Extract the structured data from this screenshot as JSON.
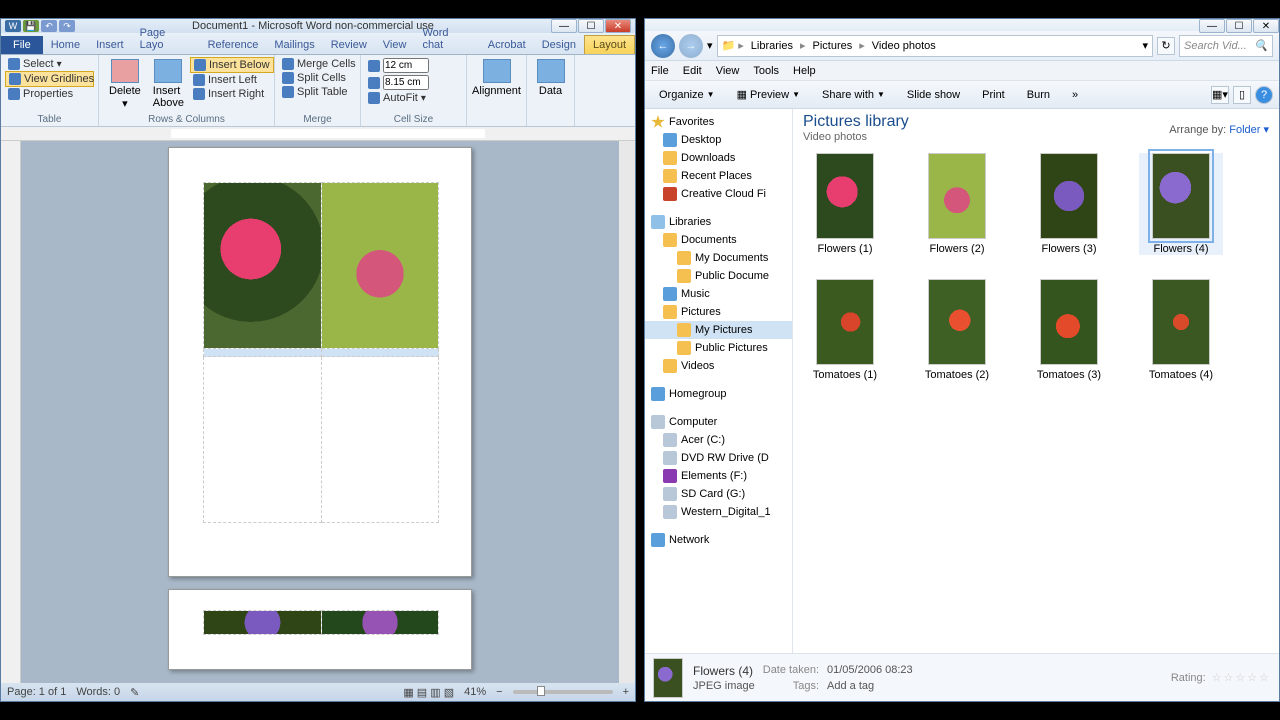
{
  "word": {
    "title": "Document1 - Microsoft Word non-commercial use",
    "tabs": {
      "file": "File",
      "home": "Home",
      "insert": "Insert",
      "pagelayout": "Page Layo",
      "references": "Reference",
      "mailings": "Mailings",
      "review": "Review",
      "view": "View",
      "wordchat": "Word chat",
      "acrobat": "Acrobat",
      "design": "Design",
      "layout": "Layout"
    },
    "ribbon": {
      "select": "Select",
      "gridlines": "View Gridlines",
      "properties": "Properties",
      "table_grp": "Table",
      "delete": "Delete",
      "insert_above": "Insert Above",
      "insert_below": "Insert Below",
      "insert_left": "Insert Left",
      "insert_right": "Insert Right",
      "rows_cols_grp": "Rows & Columns",
      "merge_cells": "Merge Cells",
      "split_cells": "Split Cells",
      "split_table": "Split Table",
      "merge_grp": "Merge",
      "height": "12 cm",
      "width": "8.15 cm",
      "autofit": "AutoFit",
      "cellsize_grp": "Cell Size",
      "alignment": "Alignment",
      "data": "Data"
    },
    "status": {
      "page": "Page: 1 of 1",
      "words": "Words: 0",
      "zoom": "41%"
    }
  },
  "explorer": {
    "breadcrumb": {
      "libraries": "Libraries",
      "pictures": "Pictures",
      "video": "Video photos"
    },
    "search_placeholder": "Search Vid...",
    "menu": {
      "file": "File",
      "edit": "Edit",
      "view": "View",
      "tools": "Tools",
      "help": "Help"
    },
    "toolbar": {
      "organize": "Organize",
      "preview": "Preview",
      "share": "Share with",
      "slideshow": "Slide show",
      "print": "Print",
      "burn": "Burn"
    },
    "nav": {
      "favorites": "Favorites",
      "desktop": "Desktop",
      "downloads": "Downloads",
      "recent": "Recent Places",
      "creative": "Creative Cloud Fi",
      "libraries": "Libraries",
      "documents": "Documents",
      "mydocs": "My Documents",
      "pubdocs": "Public Docume",
      "music": "Music",
      "pictures": "Pictures",
      "mypics": "My Pictures",
      "pubpics": "Public Pictures",
      "videos": "Videos",
      "homegroup": "Homegroup",
      "computer": "Computer",
      "acer": "Acer (C:)",
      "dvd": "DVD RW Drive (D",
      "elements": "Elements (F:)",
      "sdcard": "SD Card (G:)",
      "wd": "Western_Digital_1",
      "network": "Network"
    },
    "lib_header": "Pictures library",
    "lib_sub": "Video photos",
    "arrange_lbl": "Arrange by:",
    "arrange_val": "Folder",
    "thumbs": {
      "f1": "Flowers (1)",
      "f2": "Flowers (2)",
      "f3": "Flowers (3)",
      "f4": "Flowers (4)",
      "t1": "Tomatoes (1)",
      "t2": "Tomatoes (2)",
      "t3": "Tomatoes (3)",
      "t4": "Tomatoes (4)"
    },
    "details": {
      "name": "Flowers (4)",
      "type": "JPEG image",
      "date_lbl": "Date taken:",
      "date_val": "01/05/2006 08:23",
      "tags_lbl": "Tags:",
      "tags_val": "Add a tag",
      "rating_lbl": "Rating:"
    }
  }
}
